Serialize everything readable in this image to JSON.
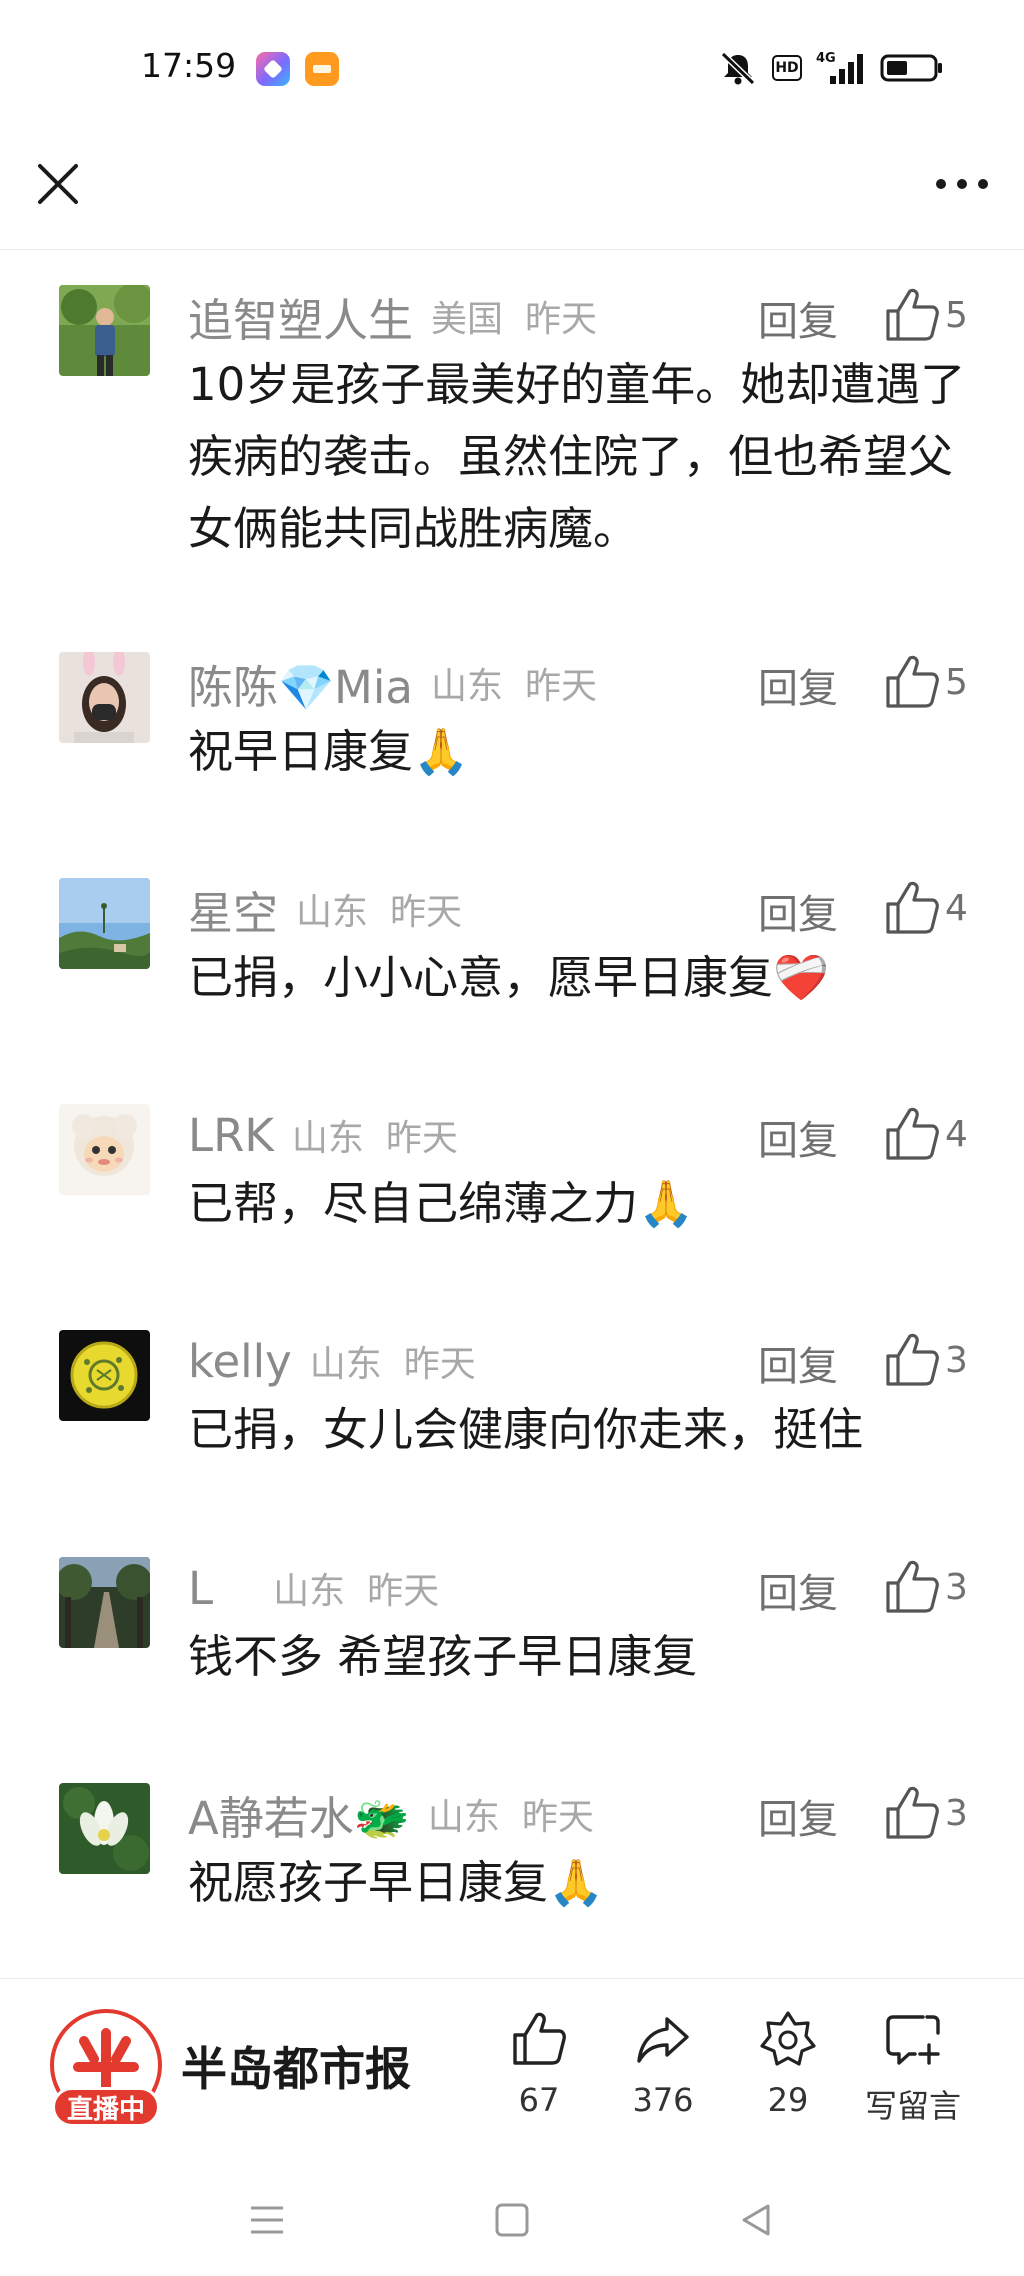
{
  "status_bar": {
    "time": "17:59",
    "app_icons": [
      "shortcut-app-icon",
      "orange-app-icon"
    ],
    "hd_label": "HD",
    "network_label": "4G"
  },
  "top_bar": {
    "close_icon": "close-icon",
    "more_icon": "more-icon"
  },
  "comments": [
    {
      "user": "追智塑人生",
      "emoji": "",
      "location": "美国",
      "time": "昨天",
      "reply": "回复",
      "likes": "5",
      "text": "10岁是孩子最美好的童年。她却遭遇了疾病的袭击。虽然住院了，但也希望父女俩能共同战胜病魔。"
    },
    {
      "user": "陈陈💎Mia",
      "emoji": "",
      "location": "山东",
      "time": "昨天",
      "reply": "回复",
      "likes": "5",
      "text": "祝早日康复🙏"
    },
    {
      "user": "星空",
      "emoji": "",
      "location": "山东",
      "time": "昨天",
      "reply": "回复",
      "likes": "4",
      "text": "已捐，小小心意，愿早日康复❤️‍🩹"
    },
    {
      "user": "LRK",
      "emoji": "",
      "location": "山东",
      "time": "昨天",
      "reply": "回复",
      "likes": "4",
      "text": "已帮，尽自己绵薄之力🙏"
    },
    {
      "user": "kelly",
      "emoji": "",
      "location": "山东",
      "time": "昨天",
      "reply": "回复",
      "likes": "3",
      "text": "已捐，女儿会健康向你走来，挺住"
    },
    {
      "user": "L",
      "emoji": "",
      "location": "山东",
      "time": "昨天",
      "reply": "回复",
      "likes": "3",
      "text": "钱不多  希望孩子早日康复"
    },
    {
      "user": "A静若水🐲",
      "emoji": "",
      "location": "山东",
      "time": "昨天",
      "reply": "回复",
      "likes": "3",
      "text": "祝愿孩子早日康复🙏"
    }
  ],
  "bottom_bar": {
    "brand_name": "半岛都市报",
    "live_label": "直播中",
    "likes": "67",
    "shares": "376",
    "favorites": "29",
    "comment_label": "写留言"
  },
  "colors": {
    "live_red": "#e23a2f",
    "meta_gray": "#a8a8a8"
  }
}
